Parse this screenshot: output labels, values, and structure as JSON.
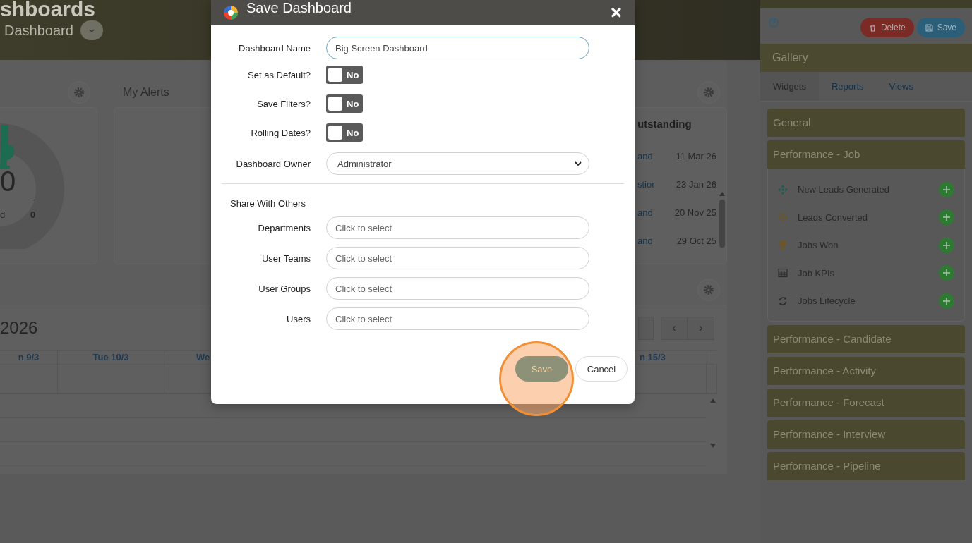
{
  "page_header": {
    "title": "shboards",
    "subtitle": "Dashboard"
  },
  "donut_widget": {
    "value": "0",
    "label": "d",
    "dash": "-",
    "count": "0"
  },
  "alerts_widget": {
    "title": "My Alerts"
  },
  "outstanding_widget": {
    "title": "utstanding",
    "rows": [
      {
        "link": "and",
        "date": "11 Mar 26"
      },
      {
        "link": "stior",
        "date": "23 Jan 26"
      },
      {
        "link": "and",
        "date": "20 Nov 25"
      },
      {
        "link": "and",
        "date": "29 Oct 25"
      }
    ]
  },
  "calendar": {
    "title": "2026",
    "nav": [
      "‹",
      "›"
    ],
    "columns": [
      "n 9/3",
      "Tue 10/3",
      "We",
      "n 15/3"
    ]
  },
  "modal": {
    "title": "Save Dashboard",
    "close": "×",
    "name_field": {
      "label": "Dashboard Name",
      "value": "Big Screen Dashboard"
    },
    "toggles": [
      {
        "label": "Set as Default?",
        "on": false,
        "text": "No"
      },
      {
        "label": "Save Filters?",
        "on": false,
        "text": "No"
      },
      {
        "label": "Rolling Dates?",
        "on": false,
        "text": "No"
      }
    ],
    "owner": {
      "label": "Dashboard Owner",
      "value": "Administrator"
    },
    "share_heading": "Share With Others",
    "share_fields": [
      {
        "label": "Departments",
        "placeholder": "Click to select"
      },
      {
        "label": "User Teams",
        "placeholder": "Click to select"
      },
      {
        "label": "User Groups",
        "placeholder": "Click to select"
      },
      {
        "label": "Users",
        "placeholder": "Click to select"
      }
    ],
    "buttons": {
      "save": "Save",
      "cancel": "Cancel"
    }
  },
  "sidebar": {
    "delete": "Delete",
    "save": "Save",
    "gallery": "Gallery",
    "tabs": [
      {
        "label": "Widgets",
        "selected": true
      },
      {
        "label": "Reports",
        "selected": false
      },
      {
        "label": "Views",
        "selected": false
      }
    ],
    "sections": [
      {
        "title": "General"
      },
      {
        "title": "Performance - Job",
        "items": [
          "New Leads Generated",
          "Leads Converted",
          "Jobs Won",
          "Job KPIs",
          "Jobs Lifecycle"
        ]
      },
      {
        "title": "Performance - Candidate"
      },
      {
        "title": "Performance - Activity"
      },
      {
        "title": "Performance - Forecast"
      },
      {
        "title": "Performance - Interview"
      },
      {
        "title": "Performance - Pipeline"
      }
    ]
  }
}
